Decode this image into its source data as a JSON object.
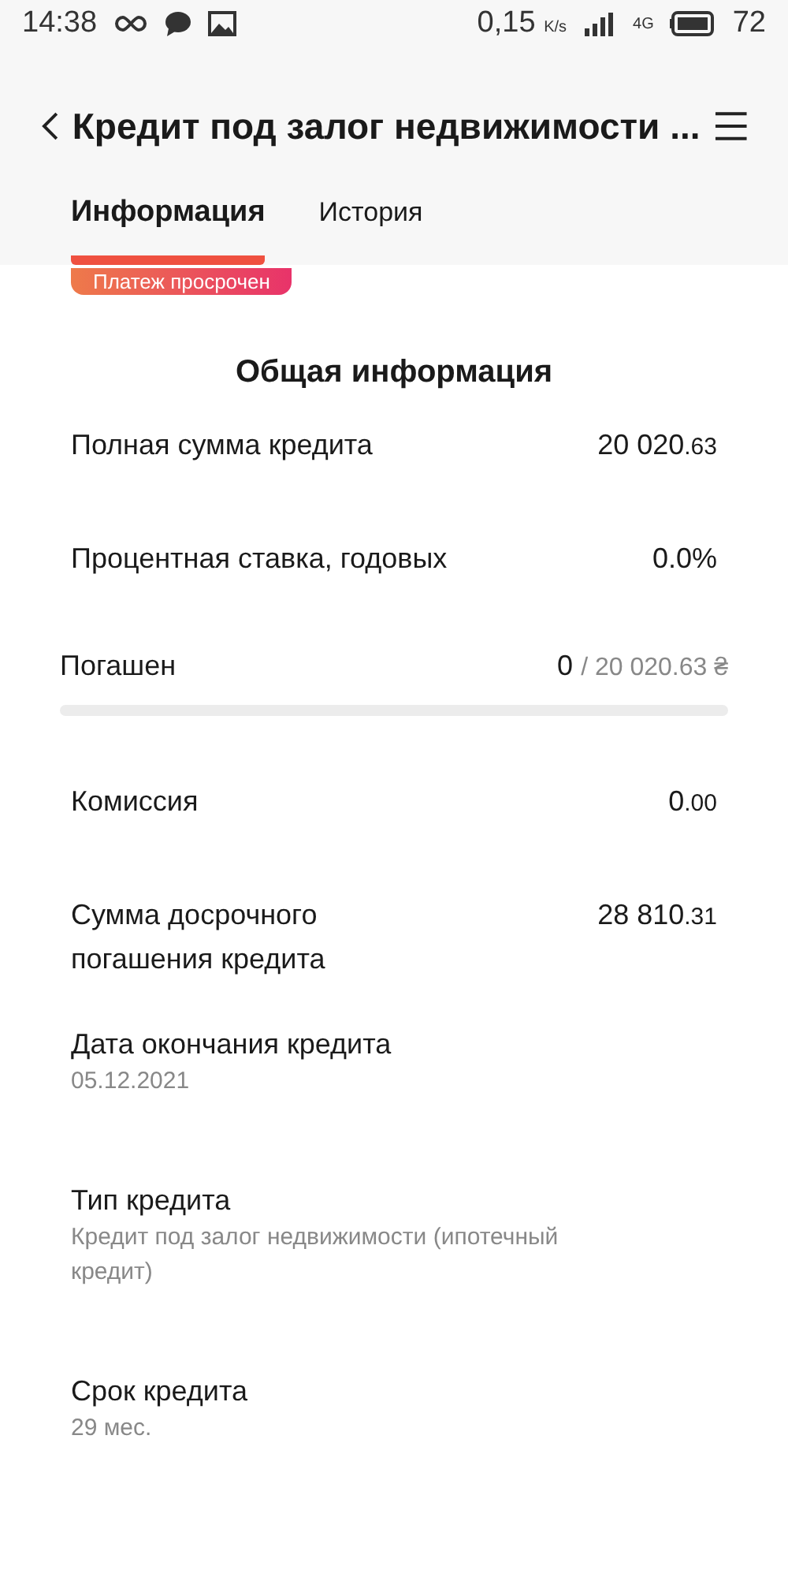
{
  "status_bar": {
    "time": "14:38",
    "speed": "0,15",
    "speed_unit": "K/s",
    "network": "4G",
    "battery": "72"
  },
  "header": {
    "title": "Кредит под залог недвижимости ..."
  },
  "tabs": [
    {
      "label": "Информация",
      "selected": true
    },
    {
      "label": "История",
      "selected": false
    }
  ],
  "badge": "Платеж просрочен",
  "section_title": "Общая информация",
  "rows": [
    {
      "kind": "amount",
      "label": "Полная сумма кредита",
      "value": "20 020",
      "fraction": ".63"
    },
    {
      "kind": "plain",
      "label": "Процентная ставка, годовых",
      "value": "0.0%"
    },
    {
      "kind": "progress",
      "label": "Погашен",
      "paid": "0",
      "total": "/ 20 020.63 ₴"
    },
    {
      "kind": "amount",
      "label": "Комиссия",
      "value": "0",
      "fraction": ".00"
    },
    {
      "kind": "amount",
      "label": "Сумма досрочного погашения кредита",
      "value": "28 810",
      "fraction": ".31"
    },
    {
      "kind": "detail",
      "label": "Дата окончания кредита",
      "value": "05.12.2021"
    },
    {
      "kind": "detail",
      "label": "Тип кредита",
      "value": "Кредит под залог недвижимости (ипотечный кредит)"
    },
    {
      "kind": "detail",
      "label": "Срок кредита",
      "value": "29 мес."
    }
  ]
}
